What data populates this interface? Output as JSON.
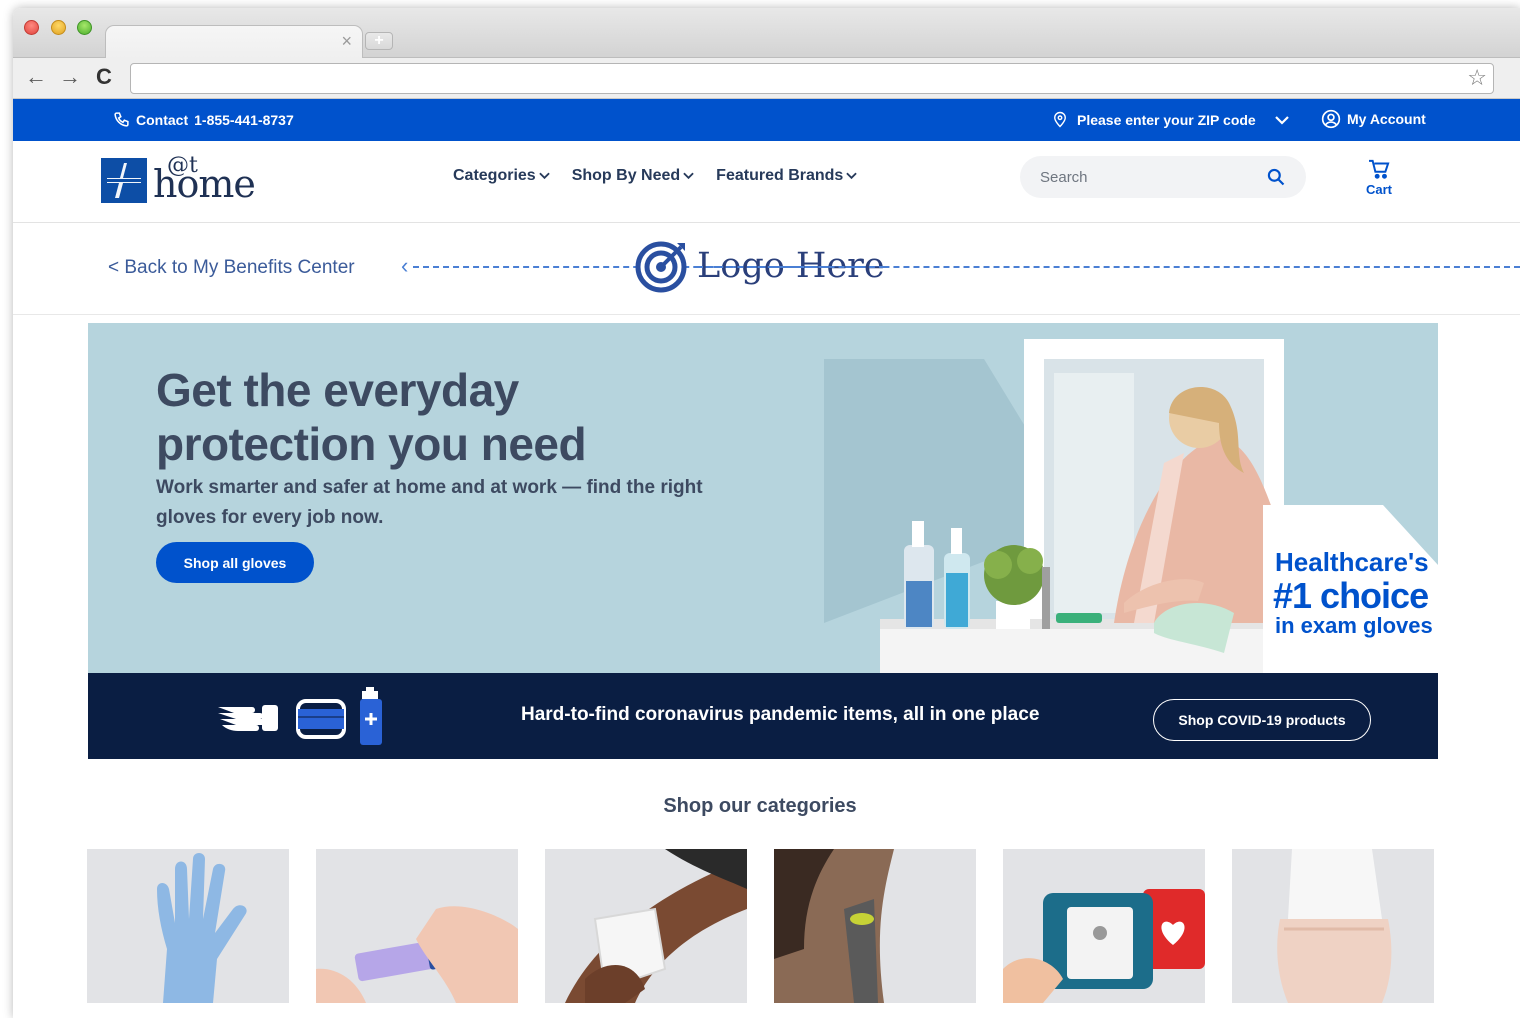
{
  "browser": {
    "tab_close": "×",
    "new_tab": "+",
    "nav_back": "←",
    "nav_forward": "→",
    "nav_reload": "C",
    "bookmark_star": "☆",
    "wrench": "🔧"
  },
  "topbar": {
    "contact_label": "Contact",
    "phone": "1-855-441-8737",
    "zip_label": "Please enter your ZIP code",
    "account_label": "My Account"
  },
  "header": {
    "brand_at": "@t",
    "brand_home": "home",
    "nav": [
      {
        "label": "Categories"
      },
      {
        "label": "Shop By Need"
      },
      {
        "label": "Featured Brands"
      }
    ],
    "search_placeholder": "Search",
    "cart_label": "Cart"
  },
  "benefits": {
    "back_label": "< Back to My Benefits Center",
    "logo_placeholder": "Logo Here"
  },
  "hero": {
    "headline": "Get the everyday protection you need",
    "subtext": "Work smarter and safer at home and at work — find the right gloves for every job now.",
    "cta_label": "Shop all gloves",
    "badge_line1": "Healthcare's",
    "badge_line2": "#1 choice",
    "badge_line3": "in exam gloves"
  },
  "covid": {
    "message": "Hard-to-find coronavirus pandemic items, all in one place",
    "button_label": "Shop COVID-19 products"
  },
  "categories": {
    "title": "Shop our categories",
    "items": [
      {
        "icon": "glove-icon"
      },
      {
        "icon": "lancet-icon"
      },
      {
        "icon": "cold-pack-icon"
      },
      {
        "icon": "thermometer-icon"
      },
      {
        "icon": "defibrillator-icon"
      },
      {
        "icon": "underwear-icon"
      }
    ]
  },
  "colors": {
    "brand_blue": "#0052cc",
    "navy": "#0a1e43",
    "hero_bg": "#b6d4dd",
    "text_dark": "#3d4a61"
  }
}
